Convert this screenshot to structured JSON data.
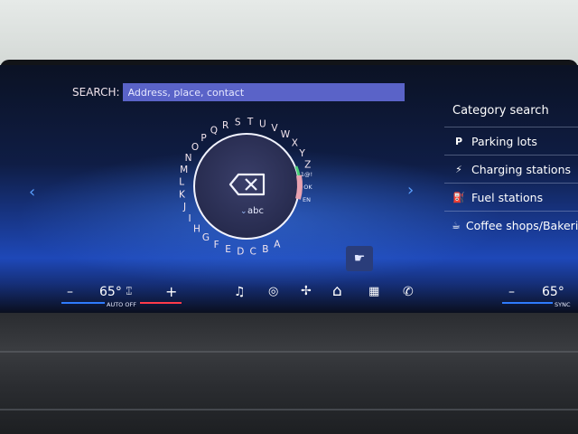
{
  "search": {
    "label": "SEARCH:",
    "placeholder": "Address, place, contact"
  },
  "keyboard": {
    "letters": [
      "A",
      "B",
      "C",
      "D",
      "E",
      "F",
      "G",
      "H",
      "I",
      "J",
      "K",
      "L",
      "M",
      "N",
      "O",
      "P",
      "Q",
      "R",
      "S",
      "T",
      "U",
      "V",
      "W",
      "X",
      "Y",
      "Z"
    ],
    "modes": [
      "1@!",
      "OK",
      "EN"
    ],
    "mode_label": "abc"
  },
  "categories": {
    "title": "Category search",
    "items": [
      {
        "label": "Parking lots",
        "icon": "parking-icon"
      },
      {
        "label": "Charging stations",
        "icon": "charging-plug-icon"
      },
      {
        "label": "Fuel stations",
        "icon": "fuel-pump-icon"
      },
      {
        "label": "Coffee shops/Bakeries",
        "icon": "coffee-cup-icon"
      }
    ]
  },
  "climate": {
    "left_temp": "65°",
    "left_label": "AUTO OFF",
    "right_temp": "65°",
    "right_label": "SYNC",
    "minus": "–",
    "plus": "+"
  },
  "colors": {
    "accent": "#5a63c8",
    "brand_blue": "#2f7bff",
    "heat_red": "#ff3b4a"
  }
}
